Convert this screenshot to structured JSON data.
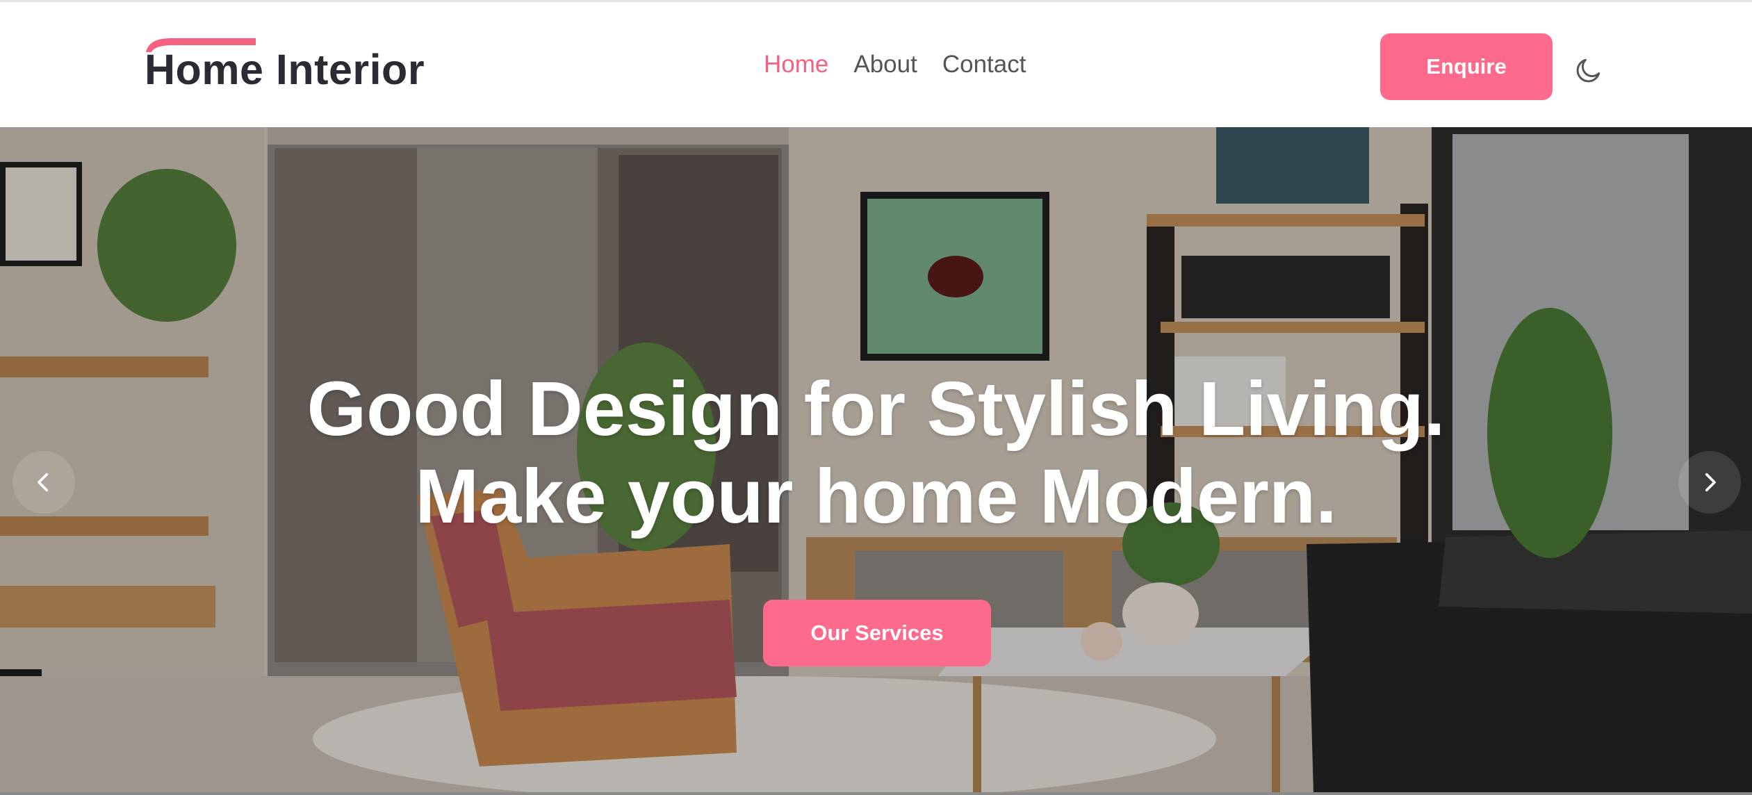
{
  "brand": {
    "name": "Home Interior",
    "accent_color": "#f4617f"
  },
  "nav": {
    "items": [
      {
        "label": "Home",
        "active": true
      },
      {
        "label": "About",
        "active": false
      },
      {
        "label": "Contact",
        "active": false
      }
    ]
  },
  "header": {
    "enquire_label": "Enquire",
    "theme_toggle_icon": "moon-icon"
  },
  "hero": {
    "headline_line1": "Good Design for Stylish Living.",
    "headline_line2": "Make your home Modern.",
    "cta_label": "Our Services",
    "prev_icon": "chevron-left-icon",
    "next_icon": "chevron-right-icon",
    "background_image": "living room interior photo"
  },
  "colors": {
    "primary": "#fe6a8b",
    "text_dark": "#2b2b33",
    "nav_text": "#555555"
  }
}
